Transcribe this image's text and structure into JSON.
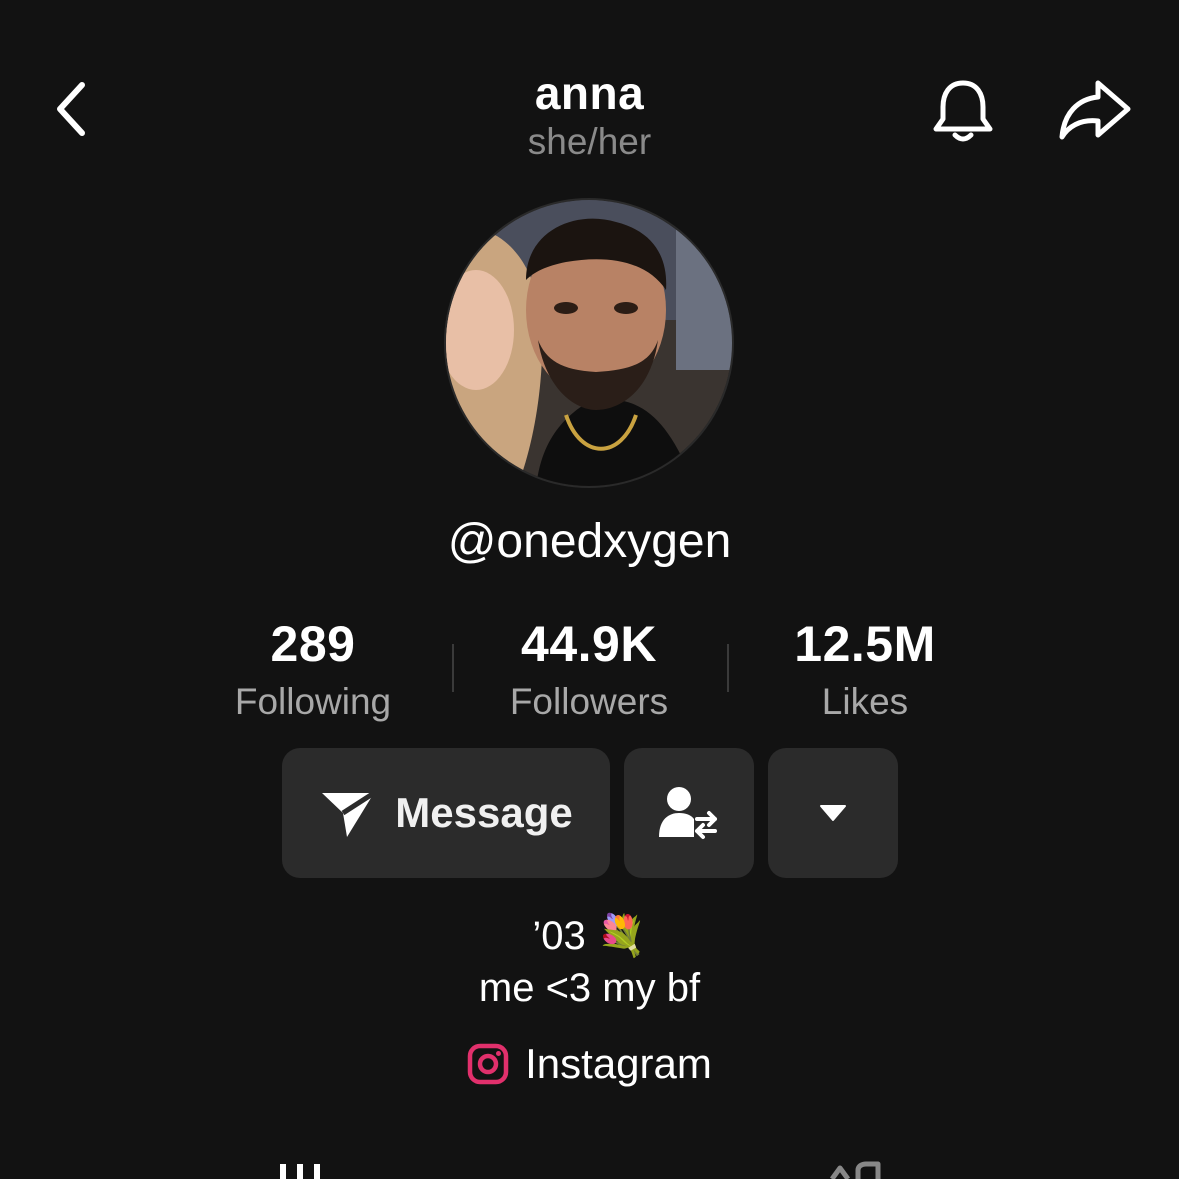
{
  "header": {
    "title": "anna",
    "pronouns": "she/her"
  },
  "profile": {
    "handle": "@onedxygen"
  },
  "stats": [
    {
      "value": "289",
      "label": "Following"
    },
    {
      "value": "44.9K",
      "label": "Followers"
    },
    {
      "value": "12.5M",
      "label": "Likes"
    }
  ],
  "actions": {
    "message_label": "Message"
  },
  "bio": {
    "line1": "’03 💐",
    "line2": "me <3 my bf"
  },
  "link": {
    "label": "Instagram"
  },
  "colors": {
    "background": "#121212",
    "button": "#2b2b2b",
    "instagram": "#e1306c"
  }
}
